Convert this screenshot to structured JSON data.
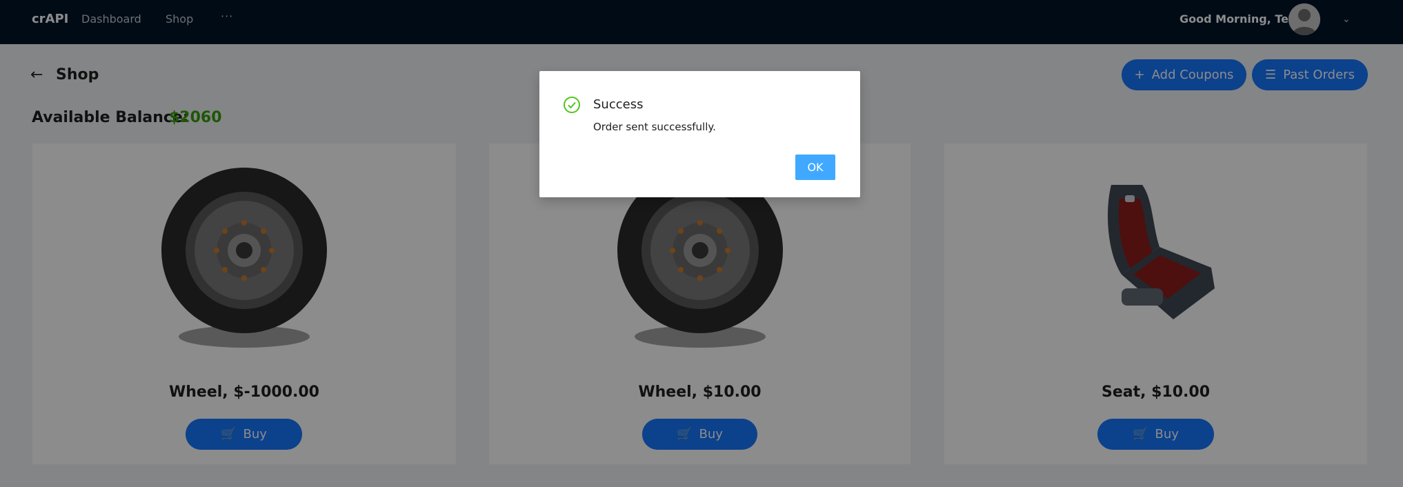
{
  "navbar": {
    "brand": "crAPI",
    "items": [
      {
        "label": "Dashboard"
      },
      {
        "label": "Shop"
      },
      {
        "label": "···"
      }
    ],
    "greeting": "Good Morning, Test!"
  },
  "page": {
    "title": "Shop",
    "balance_label": "Available Balance:",
    "balance_value": "$2060",
    "add_coupons_label": "Add Coupons",
    "past_orders_label": "Past Orders"
  },
  "products": [
    {
      "name": "Wheel, $-1000.00",
      "buy_label": "Buy",
      "image": "wheel"
    },
    {
      "name": "Wheel, $10.00",
      "buy_label": "Buy",
      "image": "wheel"
    },
    {
      "name": "Seat, $10.00",
      "buy_label": "Buy",
      "image": "seat"
    }
  ],
  "modal": {
    "title": "Success",
    "content": "Order sent successfully.",
    "ok_label": "OK",
    "icon": "check-circle-icon"
  },
  "colors": {
    "navbar_bg": "#001529",
    "primary": "#1677ff",
    "balance": "#389e0d",
    "success": "#52c41a",
    "ok_button": "#40a9ff"
  }
}
